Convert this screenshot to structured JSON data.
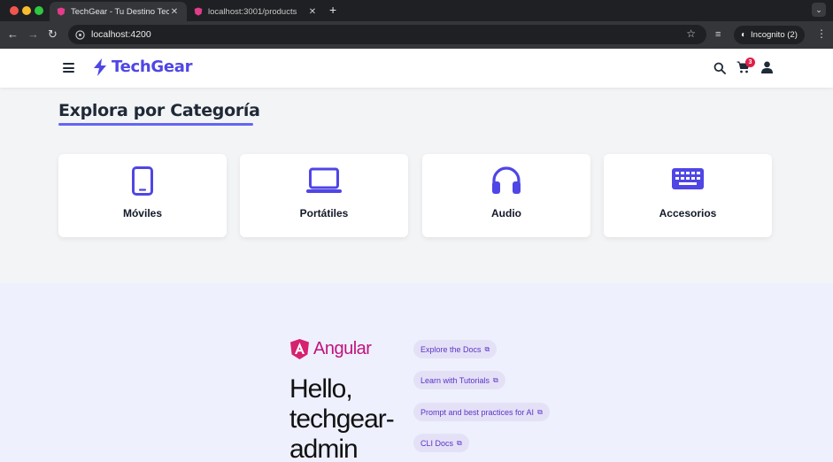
{
  "browser": {
    "tabs": [
      {
        "title": "TechGear - Tu Destino Tecnol",
        "active": true
      },
      {
        "title": "localhost:3001/products",
        "active": false
      }
    ],
    "url": "localhost:4200",
    "profile_label": "Incognito (2)"
  },
  "header": {
    "brand": "TechGear",
    "cart_count": "3"
  },
  "categories": {
    "title": "Explora por Categoría",
    "items": [
      {
        "label": "Móviles",
        "icon": "mobile-icon"
      },
      {
        "label": "Portátiles",
        "icon": "laptop-icon"
      },
      {
        "label": "Audio",
        "icon": "headphones-icon"
      },
      {
        "label": "Accesorios",
        "icon": "keyboard-icon"
      }
    ]
  },
  "angular": {
    "logo_text": "Angular",
    "hello_lines": [
      "Hello,",
      "techgear-",
      "admin"
    ],
    "links": [
      {
        "label": "Explore the Docs"
      },
      {
        "label": "Learn with Tutorials"
      },
      {
        "label": "Prompt and best practices for AI"
      },
      {
        "label": "CLI Docs"
      }
    ]
  },
  "colors": {
    "brand": "#4f46e5",
    "accent": "#6366f1",
    "badge": "#e11d48",
    "angular_magenta": "#c0137d",
    "pill_bg": "#e4e1f7"
  }
}
